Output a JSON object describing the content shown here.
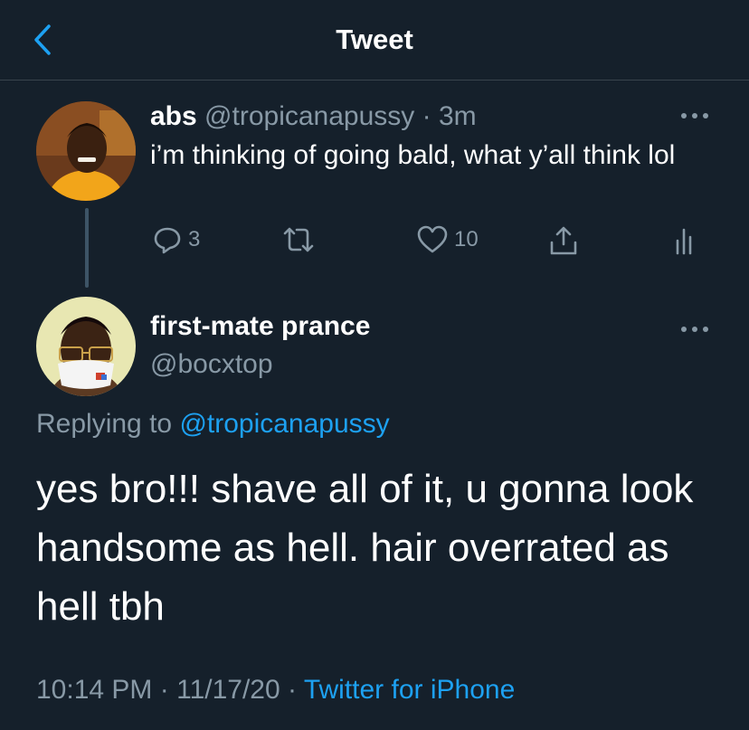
{
  "header": {
    "title": "Tweet"
  },
  "original_tweet": {
    "name": "abs",
    "handle": "@tropicanapussy",
    "separator": "·",
    "time": "3m",
    "text": "i’m thinking of going bald, what y’all think lol",
    "reply_count": "3",
    "like_count": "10"
  },
  "reply_tweet": {
    "name": "first-mate prance",
    "handle": "@bocxtop",
    "replying_label": "Replying to",
    "replying_handle": "@tropicanapussy",
    "text": "yes bro!!! shave all of it, u gonna look handsome as hell. hair overrated as hell tbh",
    "time": "10:14 PM",
    "date": "11/17/20",
    "separator": "·",
    "source": "Twitter for iPhone"
  },
  "colors": {
    "background": "#15202b",
    "accent": "#1da1f2",
    "secondary_text": "#8899a6",
    "divider": "#38444d"
  }
}
